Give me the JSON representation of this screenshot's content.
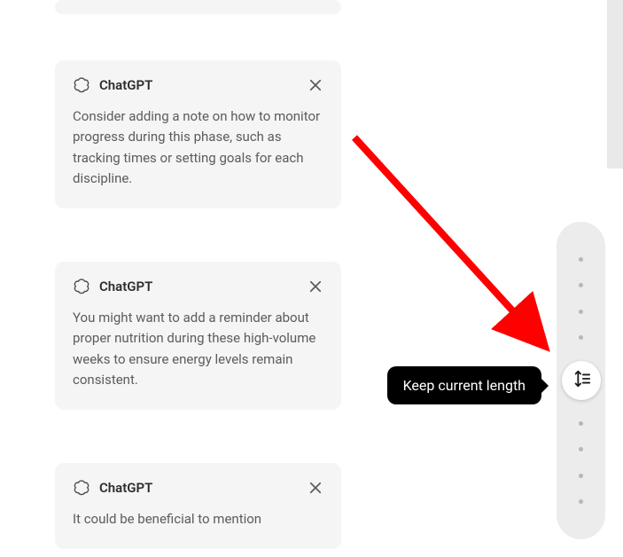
{
  "author_label": "ChatGPT",
  "icons": {
    "avatar": "chatgpt-logo-icon",
    "close": "close-icon",
    "knob": "length-adjust-icon"
  },
  "cards": [
    {
      "body": "Consider adding a note on how to monitor progress during this phase, such as tracking times or setting goals for each discipline."
    },
    {
      "body": "You might want to add a reminder about proper nutrition during these high-volume weeks to ensure energy levels remain consistent."
    },
    {
      "body": "It could be beneficial to mention"
    }
  ],
  "tooltip": "Keep current length",
  "colors": {
    "card_bg": "#f5f5f5",
    "tooltip_bg": "#000000",
    "tooltip_text": "#ffffff",
    "arrow": "#ff0000"
  }
}
